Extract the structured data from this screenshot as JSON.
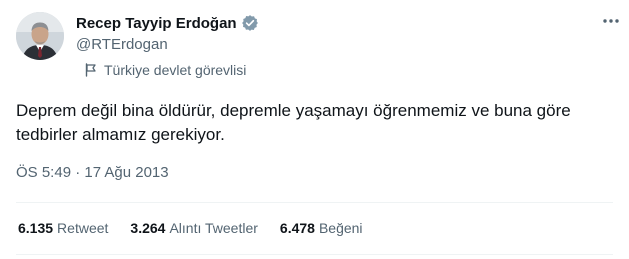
{
  "user": {
    "name": "Recep Tayyip Erdoğan",
    "handle": "@RTErdogan",
    "label": "Türkiye devlet görevlisi",
    "avatar_icon": "profile-photo",
    "verified_icon": "verified-badge-icon",
    "verified_color": "#829aab"
  },
  "tweet": {
    "text_line1": "Deprem değil bina öldürür, depremle yaşamayı öğrenmemiz ve buna göre",
    "text_line2": "tedbirler almamız gerekiyor.",
    "timestamp": "ÖS 5:49 · 17 Ağu 2013"
  },
  "stats": [
    {
      "count": "6.135",
      "label": "Retweet"
    },
    {
      "count": "3.264",
      "label": "Alıntı Tweetler"
    },
    {
      "count": "6.478",
      "label": "Beğeni"
    }
  ],
  "colors": {
    "text": "#0f1419",
    "secondary": "#536471",
    "divider": "#eff3f4"
  }
}
